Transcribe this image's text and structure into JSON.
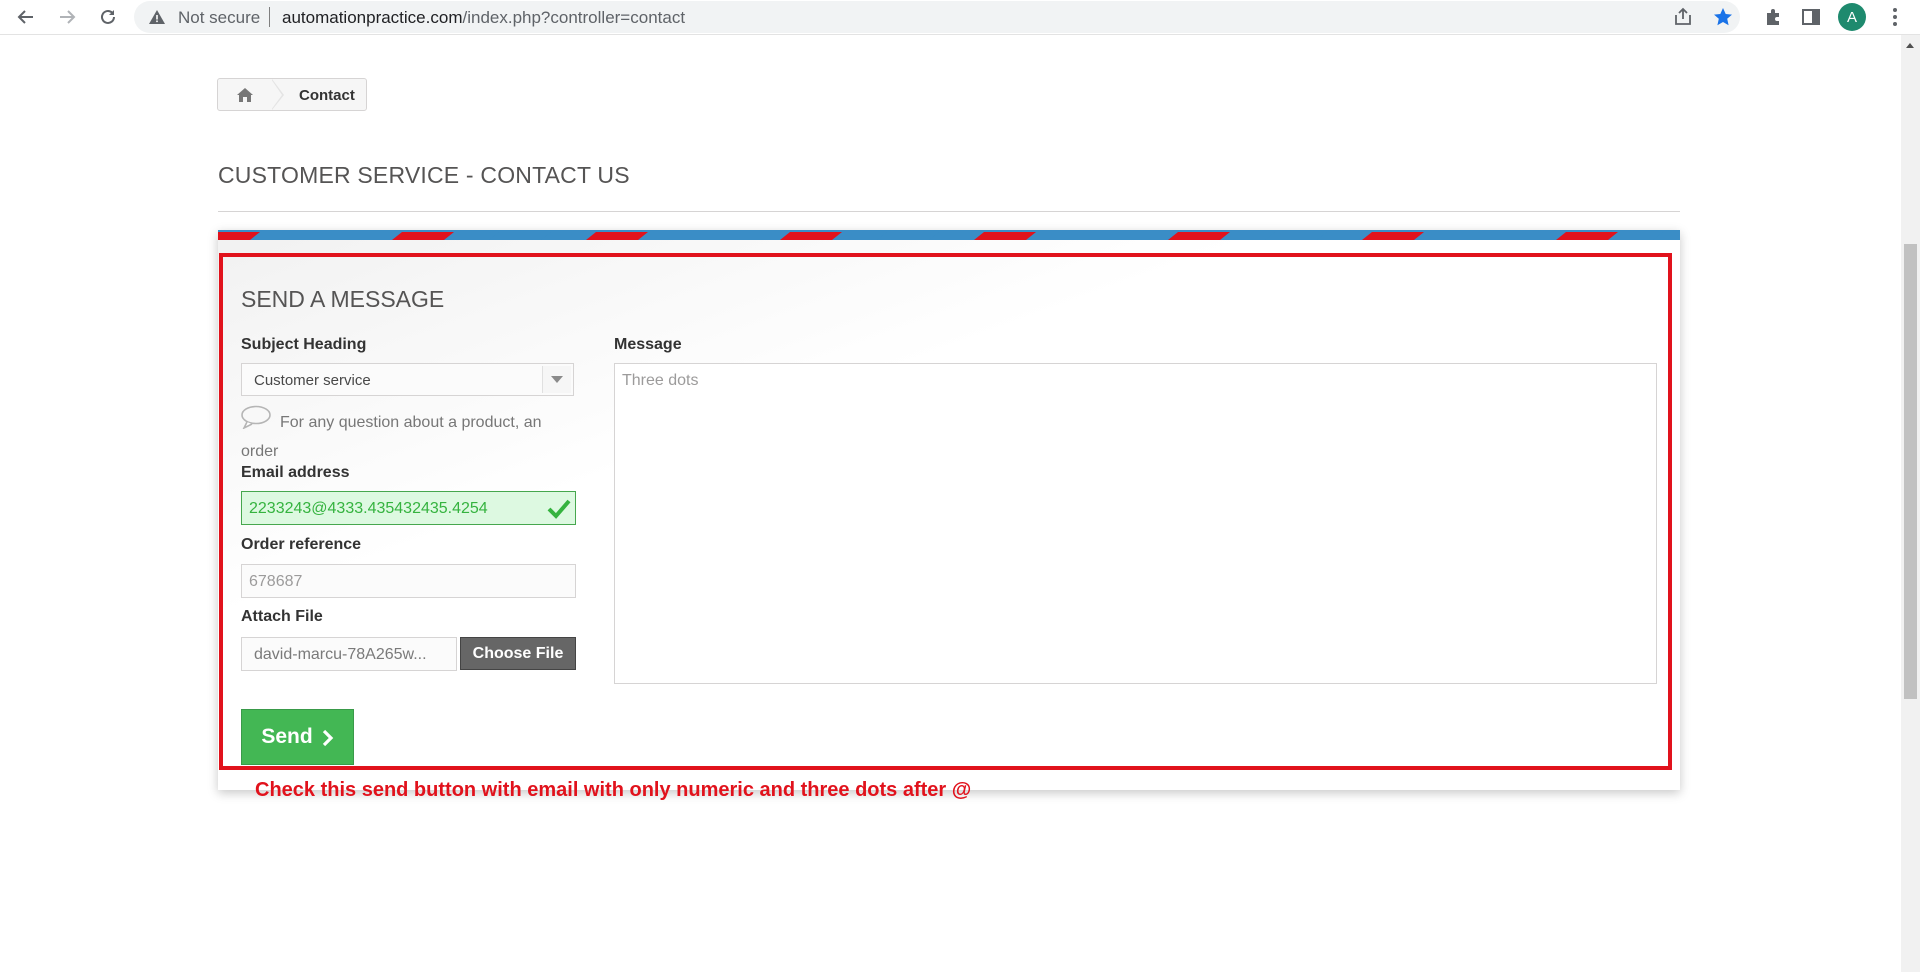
{
  "browser": {
    "security_label": "Not secure",
    "url_domain": "automationpractice.com",
    "url_path": "/index.php?controller=contact",
    "profile_initial": "A"
  },
  "breadcrumb": {
    "home_icon": "home-icon",
    "current": "Contact"
  },
  "page": {
    "heading": "CUSTOMER SERVICE - CONTACT US"
  },
  "form": {
    "title": "SEND A MESSAGE",
    "subject_label": "Subject Heading",
    "subject_value": "Customer service",
    "subject_hint": "For any question about a product, an order",
    "email_label": "Email address",
    "email_value": "2233243@4333.435432435.4254",
    "order_label": "Order reference",
    "order_value": "678687",
    "attach_label": "Attach File",
    "attach_filename": "david-marcu-78A265w...",
    "attach_button": "Choose File",
    "message_label": "Message",
    "message_value": "Three dots",
    "send_label": "Send"
  },
  "annotation": {
    "text": "Check this send button with  email with only numeric and three dots after @"
  },
  "colors": {
    "annotation_red": "#e1121c",
    "send_green": "#43b754",
    "valid_green": "#35b33f",
    "stripe_blue": "#3a8dc6",
    "stripe_red": "#e1121c"
  }
}
